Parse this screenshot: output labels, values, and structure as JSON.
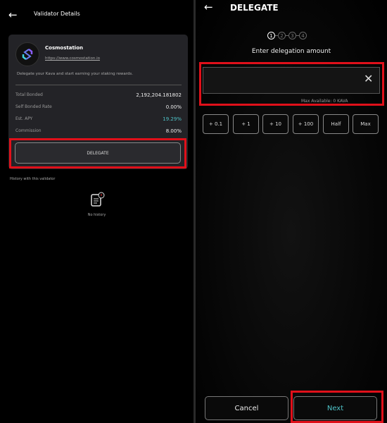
{
  "left": {
    "title": "Validator Details",
    "validator": {
      "name": "Cosmostation",
      "url": "https://www.cosmostation.io",
      "description": "Delegate your Kava and start earning your staking rewards."
    },
    "stats": [
      {
        "label": "Total Bonded",
        "value": "2,192,204.181802"
      },
      {
        "label": "Self Bonded Rate",
        "value": "0.00%"
      },
      {
        "label": "Est. APY",
        "value": "19.29%"
      },
      {
        "label": "Commission",
        "value": "8.00%"
      }
    ],
    "delegate_label": "DELEGATE",
    "history_label": "History with this validator",
    "no_history": "No history",
    "apy_color": "#4fc3c8"
  },
  "right": {
    "title": "DELEGATE",
    "steps": [
      "1",
      "2",
      "3",
      "4"
    ],
    "subtitle": "Enter delegation amount",
    "amount_value": "",
    "max_hint": "Max Available: 0 KAVA",
    "quick": [
      "+ 0.1",
      "+ 1",
      "+ 10",
      "+ 100",
      "Half",
      "Max"
    ],
    "cancel_label": "Cancel",
    "next_label": "Next",
    "next_color": "#4fc3c8"
  }
}
